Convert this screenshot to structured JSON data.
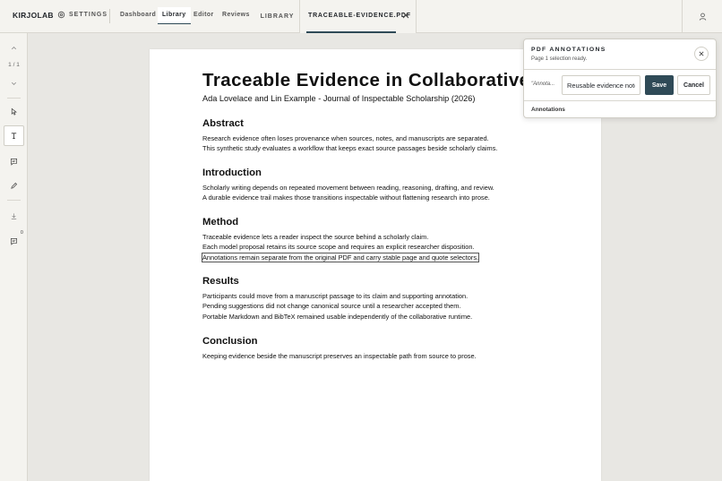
{
  "app": {
    "brand": "KIRJOLAB",
    "settings_label": "SETTINGS",
    "nav": [
      "Dashboard",
      "Library",
      "Editor",
      "Reviews"
    ],
    "library_label": "LIBRARY",
    "open_tab": "TRACEABLE-EVIDENCE.PDF",
    "accent_color": "#2f4a57"
  },
  "rail": {
    "page_count": "1 / 1",
    "badge": "0",
    "icons": [
      "chevron-up-icon",
      "chevron-down-icon",
      "cursor-icon",
      "text-select-icon",
      "comment-icon",
      "pen-icon",
      "download-icon",
      "annotations-list-icon"
    ]
  },
  "document": {
    "title": "Traceable Evidence in Collaborative Writing",
    "authors": "Ada Lovelace and Lin Example - Journal of Inspectable Scholarship (2026)",
    "sections": [
      {
        "heading": "Abstract",
        "lines": [
          "Research evidence often loses provenance when sources, notes, and manuscripts are separated.",
          "This synthetic study evaluates a workflow that keeps exact source passages beside scholarly claims."
        ]
      },
      {
        "heading": "Introduction",
        "lines": [
          "Scholarly writing depends on repeated movement between reading, reasoning, drafting, and review.",
          "A durable evidence trail makes those transitions inspectable without flattening research into prose."
        ]
      },
      {
        "heading": "Method",
        "lines": [
          "Traceable evidence lets a reader inspect the source behind a scholarly claim.",
          "Each model proposal retains its source scope and requires an explicit researcher disposition.",
          "Annotations remain separate from the original PDF and carry stable page and quote selectors."
        ]
      },
      {
        "heading": "Results",
        "lines": [
          "Participants could move from a manuscript passage to its claim and supporting annotation.",
          "Pending suggestions did not change canonical source until a researcher accepted them.",
          "Portable Markdown and BibTeX remained usable independently of the collaborative runtime."
        ]
      },
      {
        "heading": "Conclusion",
        "lines": [
          "Keeping evidence beside the manuscript preserves an inspectable path from source to prose."
        ]
      }
    ]
  },
  "panel": {
    "title": "PDF ANNOTATIONS",
    "subtitle": "Page 1 selection ready.",
    "quote_preview": "\"Annota...",
    "note_value": "Reusable evidence note",
    "save_label": "Save",
    "cancel_label": "Cancel",
    "list_label": "Annotations"
  }
}
